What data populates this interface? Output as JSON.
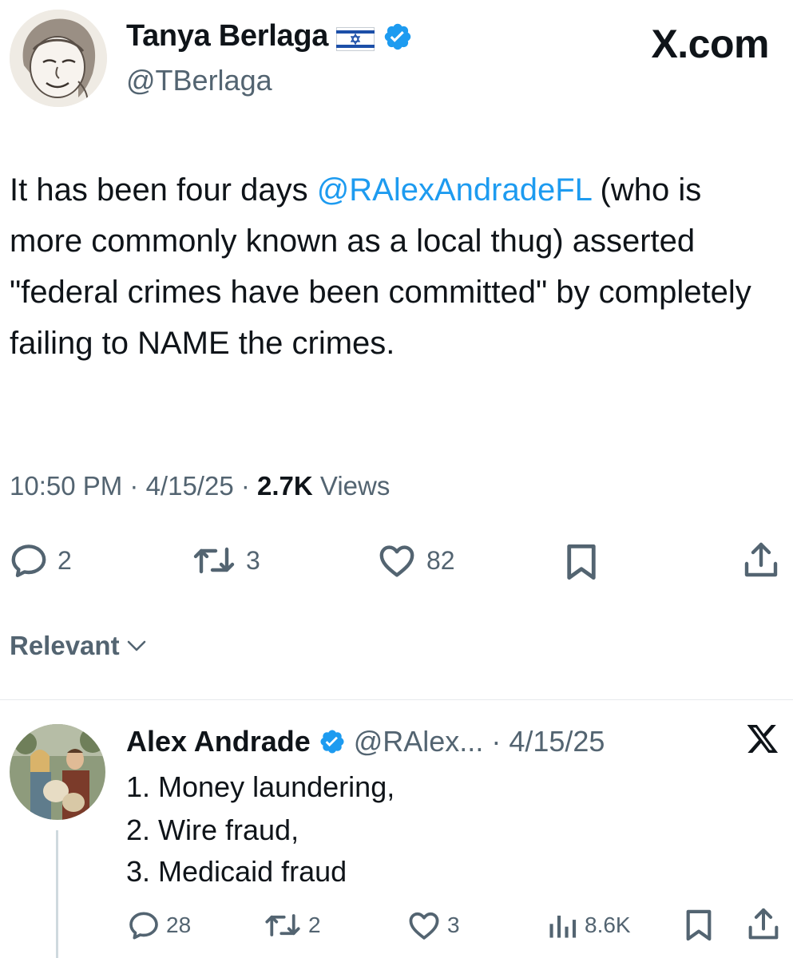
{
  "brand": "X.com",
  "tweet": {
    "author_name": "Tanya Berlaga",
    "author_handle": "@TBerlaga",
    "text_prefix": "It has been four days ",
    "mention": "@RAlexAndradeFL",
    "text_suffix": " (who is more commonly known as a local thug) asserted \"federal crimes have been committed\" by completely failing to NAME the crimes.",
    "time": "10:50 PM",
    "sep1": " · ",
    "date": "4/15/25",
    "sep2": " · ",
    "views_count": "2.7K",
    "views_label": " Views",
    "replies": "2",
    "reposts": "3",
    "likes": "82"
  },
  "sort_label": "Relevant",
  "reply": {
    "author_name": "Alex Andrade",
    "author_handle": "@RAlex...",
    "sep": "·",
    "date": "4/15/25",
    "lines": [
      "1. Money laundering,",
      "2. Wire fraud,",
      "3. Medicaid fraud"
    ],
    "replies": "28",
    "reposts": "2",
    "likes": "3",
    "views": "8.6K"
  },
  "colors": {
    "accent": "#1d9bf0",
    "text": "#0f1419",
    "secondary": "#536471"
  },
  "icons": [
    "flag-israel-icon",
    "verified-badge-icon",
    "reply-icon",
    "repost-icon",
    "like-icon",
    "bookmark-icon",
    "share-icon",
    "chevron-down-icon",
    "x-logo-icon",
    "views-icon"
  ]
}
